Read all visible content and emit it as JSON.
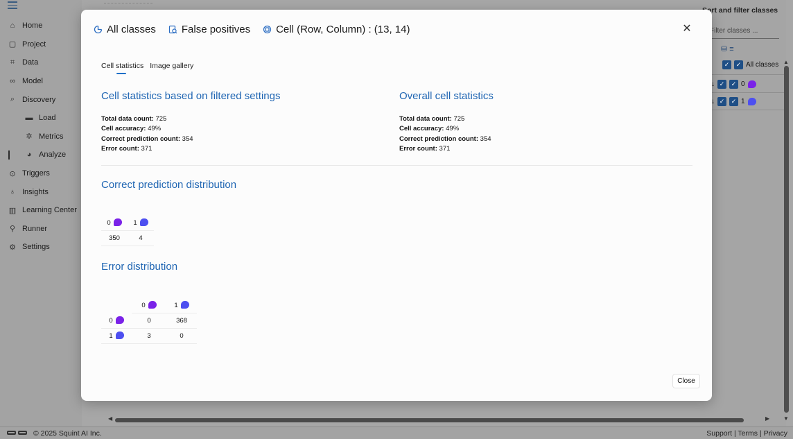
{
  "sidebar": {
    "items": [
      {
        "label": "Home",
        "icon": "home-icon",
        "glyph": "⌂"
      },
      {
        "label": "Project",
        "icon": "project-icon",
        "glyph": "▢"
      },
      {
        "label": "Data",
        "icon": "data-icon",
        "glyph": "⌗"
      },
      {
        "label": "Model",
        "icon": "model-icon",
        "glyph": "∞"
      },
      {
        "label": "Discovery",
        "icon": "discovery-icon",
        "glyph": "⌕"
      },
      {
        "label": "Load",
        "icon": "folder-icon",
        "glyph": "▬",
        "sub": true
      },
      {
        "label": "Metrics",
        "icon": "metrics-icon",
        "glyph": "✲",
        "sub": true
      },
      {
        "label": "Analyze",
        "icon": "analyze-icon",
        "glyph": "◕",
        "sub": true,
        "active": true
      },
      {
        "label": "Triggers",
        "icon": "triggers-icon",
        "glyph": "⊙"
      },
      {
        "label": "Insights",
        "icon": "insights-icon",
        "glyph": "♁"
      },
      {
        "label": "Learning Center",
        "icon": "learning-center-icon",
        "glyph": "▥"
      },
      {
        "label": "Runner",
        "icon": "runner-icon",
        "glyph": "⚲"
      },
      {
        "label": "Settings",
        "icon": "settings-icon",
        "glyph": "⚙"
      }
    ]
  },
  "right_panel": {
    "title": "Sort and filter classes",
    "filter_placeholder": "Filter classes ...",
    "all_label": "All classes",
    "class_0": "0",
    "class_1": "1"
  },
  "footer": {
    "copyright": "© 2025 Squint AI Inc.",
    "links": "Support | Terms | Privacy"
  },
  "modal": {
    "header": {
      "all_classes": "All classes",
      "false_positives": "False positives",
      "cell": "Cell (Row, Column) : (13, 14)"
    },
    "tabs": {
      "stats": "Cell statistics",
      "gallery": "Image gallery"
    },
    "filtered": {
      "title": "Cell statistics based on filtered settings",
      "total_label": "Total data count:",
      "total": "725",
      "acc_label": "Cell accuracy:",
      "acc": "49%",
      "correct_label": "Correct prediction count:",
      "correct": "354",
      "error_label": "Error count:",
      "error": "371"
    },
    "overall": {
      "title": "Overall cell statistics",
      "total_label": "Total data count:",
      "total": "725",
      "acc_label": "Cell accuracy:",
      "acc": "49%",
      "correct_label": "Correct prediction count:",
      "correct": "354",
      "error_label": "Error count:",
      "error": "371"
    },
    "correct_dist": {
      "title": "Correct prediction distribution",
      "c0": "0",
      "c1": "1",
      "v0": "350",
      "v1": "4"
    },
    "error_dist": {
      "title": "Error distribution",
      "col0": "0",
      "col1": "1",
      "row0": "0",
      "row1": "1",
      "r0c0": "0",
      "r0c1": "368",
      "r1c0": "3",
      "r1c1": "0"
    },
    "close_label": "Close"
  },
  "colors": {
    "class_0": "#7a22e8",
    "class_1": "#4d4ff0",
    "accent": "#2066b3"
  }
}
